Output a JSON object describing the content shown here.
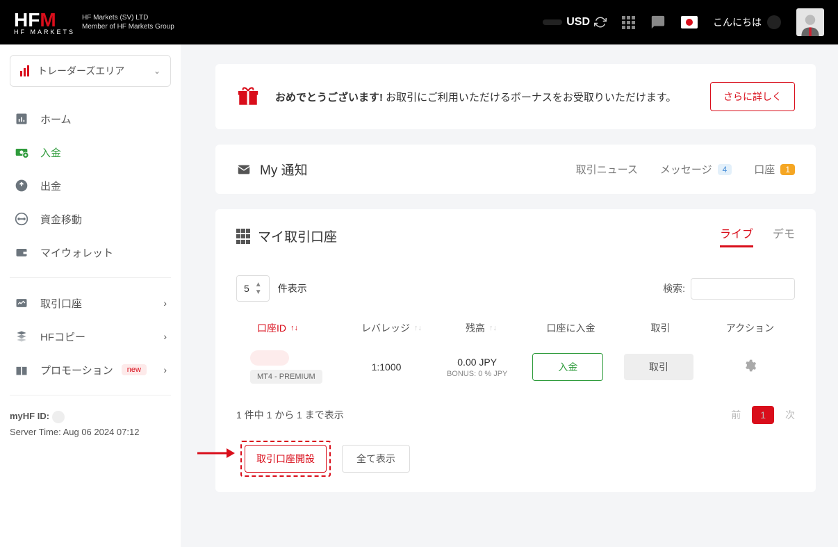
{
  "top": {
    "company1": "HF Markets (SV) LTD",
    "company2": "Member of HF Markets Group",
    "currency": "USD",
    "greeting": "こんにちは"
  },
  "sidebar": {
    "trader_area": "トレーダーズエリア",
    "items": [
      "ホーム",
      "入金",
      "出金",
      "資金移動",
      "マイウォレット",
      "取引口座",
      "HFコピー",
      "プロモーション"
    ],
    "new_badge": "new",
    "myhf_id_label": "myHF ID:",
    "server_time": "Server Time: Aug 06 2024 07:12"
  },
  "bonus": {
    "bold": "おめでとうございます!",
    "rest": " お取引にご利用いただけるボーナスをお受取りいただけます。",
    "button": "さらに詳しく"
  },
  "notify": {
    "title": "My 通知",
    "tabs": {
      "news": "取引ニュース",
      "messages": "メッセージ",
      "accounts": "口座"
    },
    "msg_count": "4",
    "acc_count": "1"
  },
  "accounts": {
    "title": "マイ取引口座",
    "tab_live": "ライブ",
    "tab_demo": "デモ",
    "page_size": "5",
    "page_size_label": "件表示",
    "search_label": "検索:",
    "headers": {
      "id": "口座ID",
      "leverage": "レバレッジ",
      "balance": "残高",
      "deposit": "口座に入金",
      "trade": "取引",
      "action": "アクション"
    },
    "row": {
      "type": "MT4 - PREMIUM",
      "leverage": "1:1000",
      "balance": "0.00 JPY",
      "bonus": "BONUS: 0 % JPY",
      "deposit_btn": "入金",
      "trade_btn": "取引"
    },
    "footer_info": "1 件中 1 から 1 まで表示",
    "prev": "前",
    "page": "1",
    "next": "次",
    "new_account": "取引口座開設",
    "show_all": "全て表示"
  }
}
